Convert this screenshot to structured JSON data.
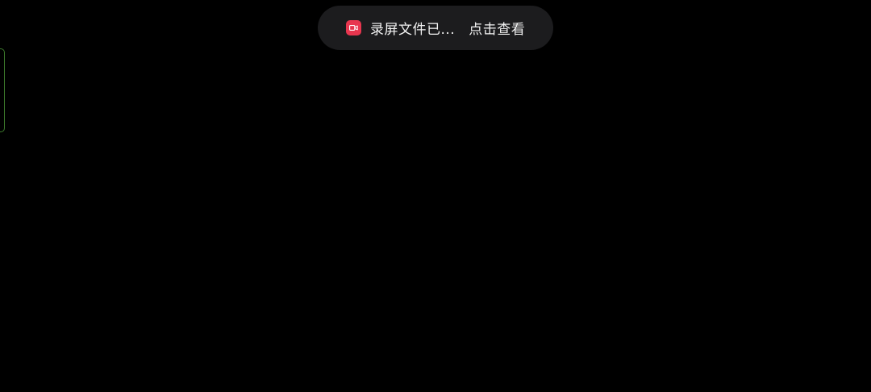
{
  "toast": {
    "icon": "screen-record-icon",
    "icon_color": "#e8364f",
    "message": "录屏文件已...",
    "action_label": "点击查看"
  },
  "edge_handle": {
    "accent_color": "#3d7a2c"
  }
}
